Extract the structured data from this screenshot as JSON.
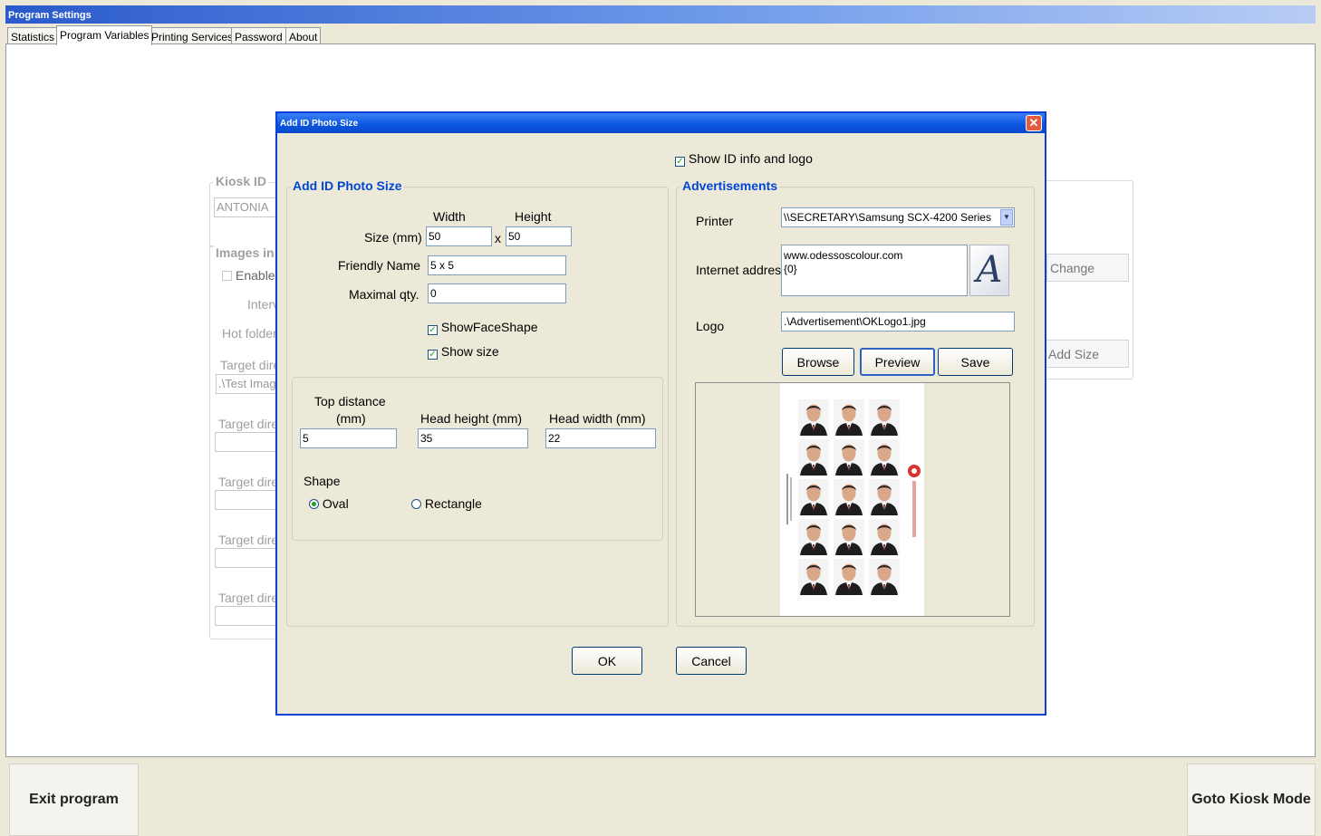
{
  "window": {
    "title": "Program Settings"
  },
  "tabs": [
    {
      "label": "Statistics"
    },
    {
      "label": "Program Variables"
    },
    {
      "label": "Printing Services"
    },
    {
      "label": "Password"
    },
    {
      "label": "About"
    }
  ],
  "background": {
    "kiosk_id_label": "Kiosk ID",
    "kiosk_id_value": "ANTONIA",
    "images_in_label": "Images in",
    "enable_label": "Enable",
    "interval_label": "Interv",
    "hot_folder_label": "Hot folder",
    "target_dir_label": "Target dire",
    "target_dir_value": ".\\Test Imag",
    "change_button": "Change",
    "add_size_button": "Add Size"
  },
  "dialog": {
    "title": "Add ID Photo Size",
    "show_id_info": {
      "label": "Show ID info and logo",
      "checked": true
    },
    "photo_size": {
      "group_title": "Add ID Photo Size",
      "width_label": "Width",
      "height_label": "Height",
      "size_label": "Size (mm)",
      "width_value": "50",
      "times": "x",
      "height_value": "50",
      "friendly_name_label": "Friendly Name",
      "friendly_name_value": "5 x 5",
      "max_qty_label": "Maximal qty.",
      "max_qty_value": "0",
      "show_face_shape": {
        "label": "ShowFaceShape",
        "checked": true
      },
      "show_size": {
        "label": "Show size",
        "checked": true
      },
      "top_distance_label_1": "Top distance",
      "top_distance_label_2": "(mm)",
      "top_distance_value": "5",
      "head_height_label": "Head height (mm)",
      "head_height_value": "35",
      "head_width_label": "Head width (mm)",
      "head_width_value": "22",
      "shape_label": "Shape",
      "shape_oval": "Oval",
      "shape_rectangle": "Rectangle",
      "shape_selected": "Oval"
    },
    "ads": {
      "group_title": "Advertisements",
      "printer_label": "Printer",
      "printer_value": "\\\\SECRETARY\\Samsung SCX-4200 Series",
      "internet_label": "Internet address",
      "internet_line1": "www.odessoscolour.com",
      "internet_line2": "{0}",
      "font_icon_glyph": "A",
      "logo_label": "Logo",
      "logo_value": ".\\Advertisement\\OKLogo1.jpg",
      "browse_button": "Browse",
      "preview_button": "Preview",
      "save_button": "Save"
    },
    "ok_button": "OK",
    "cancel_button": "Cancel"
  },
  "footer": {
    "exit_button": "Exit program",
    "kiosk_button": "Goto Kiosk Mode"
  },
  "colors": {
    "dialog_border": "#0a3fd8",
    "group_title": "#0046d5",
    "face": "#ece9d8"
  }
}
